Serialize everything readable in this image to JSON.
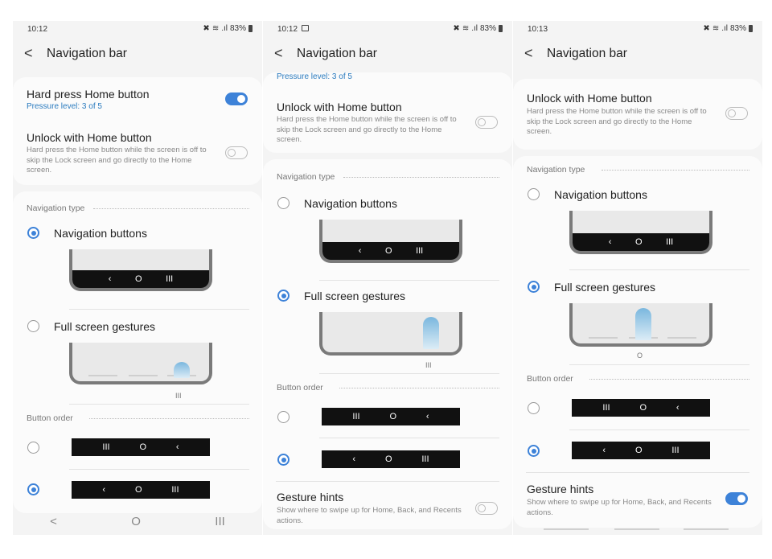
{
  "glyphs": {
    "back": "<",
    "home": "O",
    "recents": "III",
    "nav_back": "‹",
    "mute": "✖",
    "wifi": "≋",
    "signal": ".ıl"
  },
  "colors": {
    "accent": "#3d82d8",
    "background": "#f4f4f4",
    "card": "#fbfbfb"
  },
  "screen1": {
    "status_time": "10:12",
    "battery": "83%",
    "title": "Navigation bar",
    "hard_press_title": "Hard press Home button",
    "pressure_level": "Pressure level: 3 of 5",
    "hard_press_on": true,
    "unlock_title": "Unlock with Home button",
    "unlock_desc": "Hard press the Home button while the screen is off to skip the Lock screen and go directly to the Home screen.",
    "unlock_on": false,
    "nav_type_label": "Navigation type",
    "nav_buttons_label": "Navigation buttons",
    "gestures_label": "Full screen gestures",
    "selected_nav_type": "Navigation buttons",
    "button_order_label": "Button order",
    "selected_order": 2
  },
  "screen2": {
    "status_time": "10:12",
    "battery": "83%",
    "title": "Navigation bar",
    "pressure_level": "Pressure level: 3 of 5",
    "unlock_title": "Unlock with Home button",
    "unlock_desc": "Hard press the Home button while the screen is off to skip the Lock screen and go directly to the Home screen.",
    "unlock_on": false,
    "nav_type_label": "Navigation type",
    "nav_buttons_label": "Navigation buttons",
    "gestures_label": "Full screen gestures",
    "selected_nav_type": "Full screen gestures",
    "button_order_label": "Button order",
    "selected_order": 2,
    "gesture_hints_title": "Gesture hints",
    "gesture_hints_desc": "Show where to swipe up for Home, Back, and Recents actions.",
    "gesture_hints_on": false
  },
  "screen3": {
    "status_time": "10:13",
    "battery": "83%",
    "title": "Navigation bar",
    "unlock_title": "Unlock with Home button",
    "unlock_desc": "Hard press the Home button while the screen is off to skip the Lock screen and go directly to the Home screen.",
    "unlock_on": false,
    "nav_type_label": "Navigation type",
    "nav_buttons_label": "Navigation buttons",
    "gestures_label": "Full screen gestures",
    "selected_nav_type": "Full screen gestures",
    "button_order_label": "Button order",
    "selected_order": 2,
    "gesture_hints_title": "Gesture hints",
    "gesture_hints_desc": "Show where to swipe up for Home, Back, and Recents actions.",
    "gesture_hints_on": true
  }
}
